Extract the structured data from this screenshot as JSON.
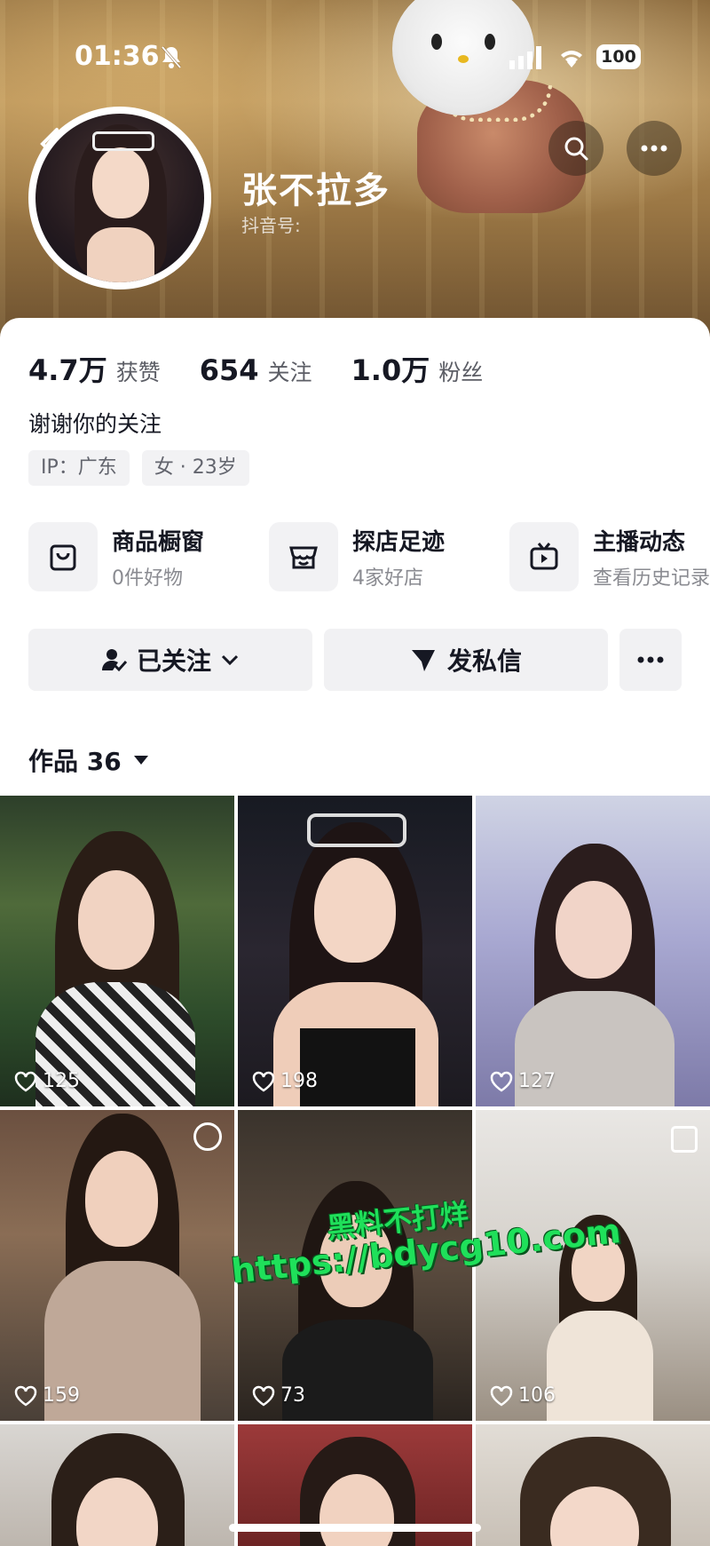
{
  "status_bar": {
    "time": "01:36",
    "battery": "100"
  },
  "profile": {
    "name": "张不拉多",
    "douyin_id_label": "抖音号:",
    "stats": [
      {
        "value": "4.7万",
        "label": "获赞"
      },
      {
        "value": "654",
        "label": "关注"
      },
      {
        "value": "1.0万",
        "label": "粉丝"
      }
    ],
    "bio": "谢谢你的关注",
    "tags": [
      "IP：广东",
      "女 · 23岁"
    ]
  },
  "services": [
    {
      "title": "商品橱窗",
      "subtitle": "0件好物",
      "icon": "shop-bag-icon"
    },
    {
      "title": "探店足迹",
      "subtitle": "4家好店",
      "icon": "store-icon"
    },
    {
      "title": "主播动态",
      "subtitle": "查看历史记录",
      "icon": "tv-icon"
    }
  ],
  "actions": {
    "follow": "已关注",
    "message": "发私信"
  },
  "works": {
    "label": "作品 36",
    "videos": [
      {
        "likes": "125"
      },
      {
        "likes": "198"
      },
      {
        "likes": "127"
      },
      {
        "likes": "159"
      },
      {
        "likes": "73"
      },
      {
        "likes": "106"
      }
    ]
  },
  "watermark": {
    "line1": "黑料不打烊",
    "line2": "https://bdycg10.com"
  },
  "colors": {
    "text": "#161823",
    "subtle": "#8a8b91",
    "button_bg": "#f1f1f3",
    "watermark": "#1fe05a"
  }
}
